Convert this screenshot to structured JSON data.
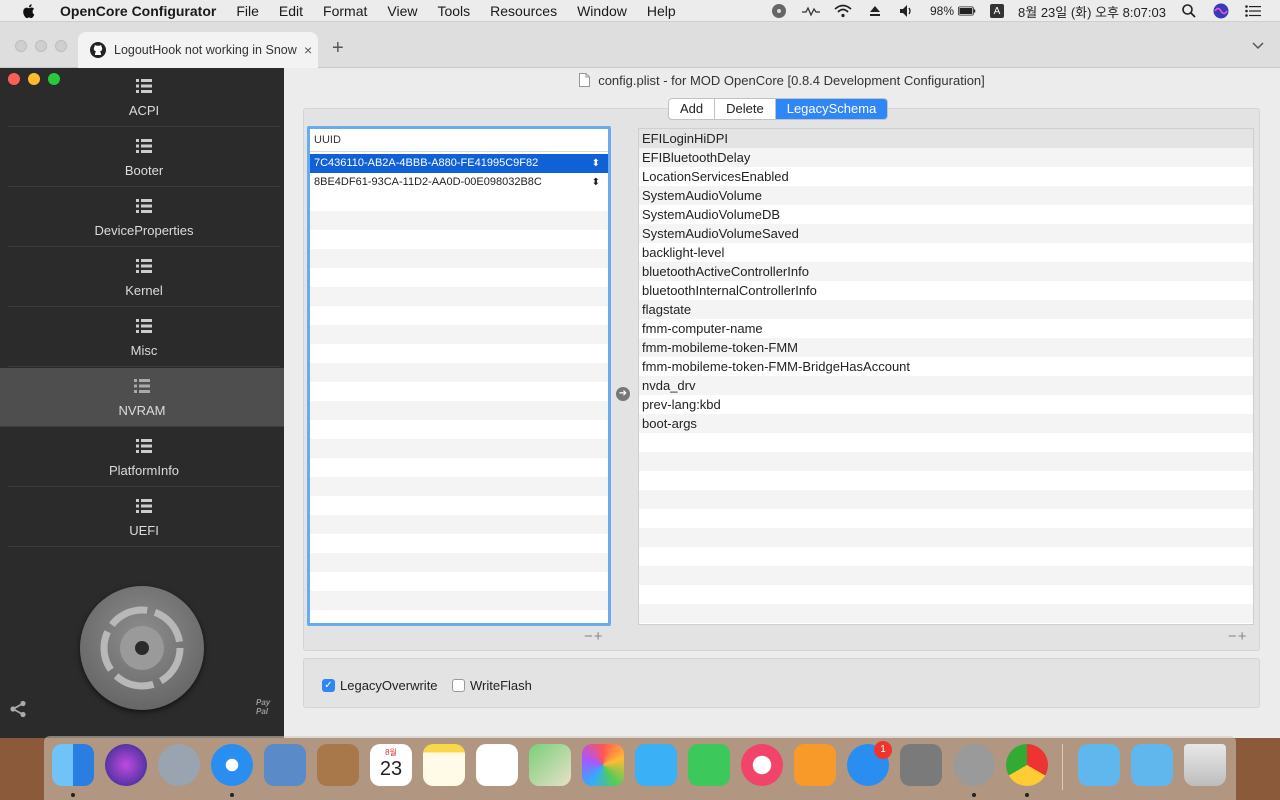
{
  "menubar": {
    "app_name": "OpenCore Configurator",
    "items": [
      "File",
      "Edit",
      "Format",
      "View",
      "Tools",
      "Resources",
      "Window",
      "Help"
    ],
    "battery": "98%",
    "input_method": "A",
    "clock": "8월 23일 (화) 오후  8:07:03"
  },
  "browser": {
    "tab_title": "LogoutHook not working in Snow",
    "close": "×",
    "new_tab": "+"
  },
  "window": {
    "title": "config.plist - for MOD OpenCore [0.8.4 Development Configuration]",
    "sidebar": [
      {
        "label": "ACPI"
      },
      {
        "label": "Booter"
      },
      {
        "label": "DeviceProperties"
      },
      {
        "label": "Kernel"
      },
      {
        "label": "Misc"
      },
      {
        "label": "NVRAM",
        "active": true
      },
      {
        "label": "PlatformInfo"
      },
      {
        "label": "UEFI"
      }
    ],
    "paypal": [
      "Pay",
      "Pal"
    ],
    "segments": [
      {
        "label": "Add"
      },
      {
        "label": "Delete"
      },
      {
        "label": "LegacySchema",
        "selected": true
      }
    ],
    "uuid_table": {
      "header": "UUID",
      "rows": [
        "7C436110-AB2A-4BBB-A880-FE41995C9F82",
        "8BE4DF61-93CA-11D2-AA0D-00E098032B8C"
      ],
      "selected_index": 0
    },
    "var_table": {
      "rows": [
        "EFILoginHiDPI",
        "EFIBluetoothDelay",
        "LocationServicesEnabled",
        "SystemAudioVolume",
        "SystemAudioVolumeDB",
        "SystemAudioVolumeSaved",
        "backlight-level",
        "bluetoothActiveControllerInfo",
        "bluetoothInternalControllerInfo",
        "flagstate",
        "fmm-computer-name",
        "fmm-mobileme-token-FMM",
        "fmm-mobileme-token-FMM-BridgeHasAccount",
        "nvda_drv",
        "prev-lang:kbd",
        "boot-args"
      ]
    },
    "plus_minus": "−+",
    "options": {
      "legacy_overwrite": {
        "label": "LegacyOverwrite",
        "checked": true
      },
      "write_flash": {
        "label": "WriteFlash",
        "checked": false
      }
    }
  },
  "dock": {
    "calendar_month": "8월",
    "calendar_day": "23",
    "appstore_badge": "1",
    "apps": [
      "finder",
      "siri",
      "launchpad",
      "safari",
      "mail",
      "contacts",
      "calendar",
      "notes",
      "reminders",
      "maps",
      "photos",
      "messages",
      "facetime",
      "music",
      "books",
      "app-store",
      "system-preferences",
      "opencore-configurator",
      "chrome",
      "applications-folder",
      "downloads-folder",
      "trash"
    ]
  },
  "colors": {
    "accent": "#2f86f6",
    "selection": "#1060d8",
    "sidebar_bg": "#2b2b2b",
    "sidebar_active": "#4e4e4e"
  }
}
